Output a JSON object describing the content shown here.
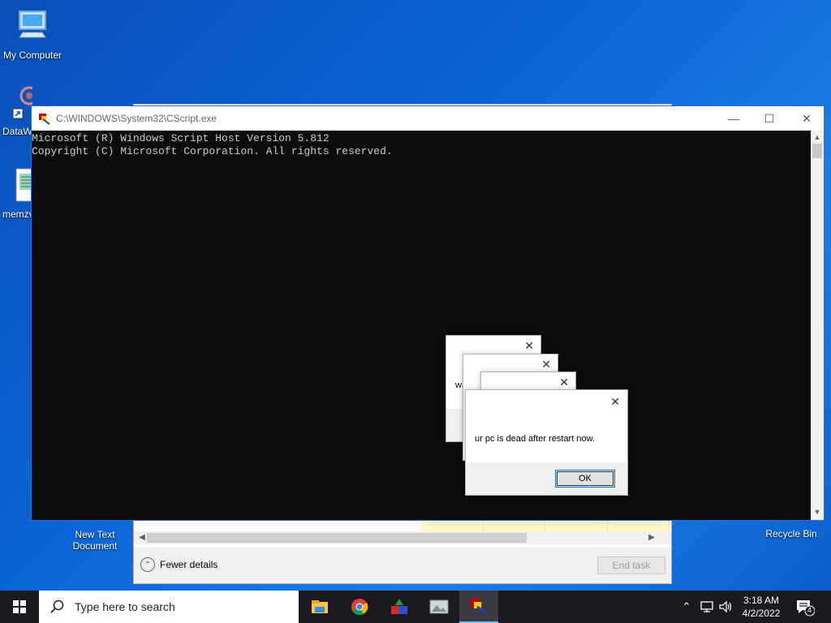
{
  "desktop": {
    "icons": [
      {
        "label": "My Computer",
        "icon": "computer-icon"
      },
      {
        "label": "DataW",
        "icon": "network-icon"
      },
      {
        "label": "memzv",
        "icon": "script-file-icon"
      },
      {
        "label": "New Text Document",
        "icon": "text-document-icon"
      },
      {
        "label": "Recycle Bin",
        "icon": "recycle-bin-icon"
      }
    ],
    "background_color": "#0a64d6"
  },
  "task_manager": {
    "fewer_details": "Fewer details",
    "end_task": "End task"
  },
  "console": {
    "title": "C:\\WINDOWS\\System32\\CScript.exe",
    "lines": [
      "Microsoft (R) Windows Script Host Version 5.812",
      "Copyright (C) Microsoft Corporation. All rights reserved."
    ],
    "background": "#0c0c0c",
    "text_color": "#cccccc"
  },
  "dialogs": {
    "back_text": "want a",
    "main_text": "ur pc is dead after restart now.",
    "ok_label": "OK"
  },
  "taskbar": {
    "search_placeholder": "Type here to search",
    "apps": [
      "file-explorer-icon",
      "chrome-icon",
      "shapes-app-icon",
      "image-viewer-icon",
      "cscript-icon"
    ],
    "time": "3:18 AM",
    "date": "4/2/2022",
    "notification_count": "4"
  }
}
